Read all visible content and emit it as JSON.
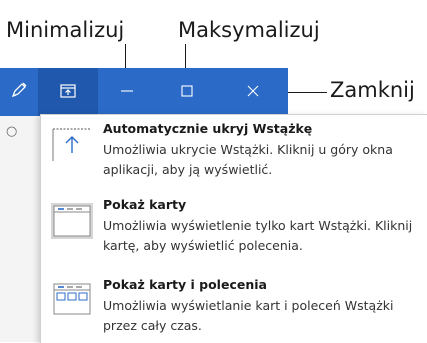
{
  "callouts": {
    "minimize": "Minimalizuj",
    "maximize": "Maksymalizuj",
    "close": "Zamknij"
  },
  "titlebar": {
    "color": "#2b6bc7",
    "active_button_color": "#1f58ad",
    "icons": {
      "pen": "pen-icon",
      "ribbon_display_options": "ribbon-display-options-icon",
      "minimize": "minimize-icon",
      "maximize": "maximize-icon",
      "close": "close-icon"
    }
  },
  "menu": {
    "items": [
      {
        "icon": "auto-hide-ribbon-icon",
        "title": "Automatycznie ukryj Wstążkę",
        "description": "Umożliwia ukrycie Wstążki. Kliknij u góry okna aplikacji, aby ją wyświetlić."
      },
      {
        "icon": "show-tabs-icon",
        "title": "Pokaż karty",
        "description": "Umożliwia wyświetlenie tylko kart Wstążki. Kliknij kartę, aby wyświetlić polecenia."
      },
      {
        "icon": "show-tabs-and-commands-icon",
        "title": "Pokaż karty i polecenia",
        "description": "Umożliwia wyświetlanie kart i poleceń Wstążki przez cały czas."
      }
    ]
  }
}
